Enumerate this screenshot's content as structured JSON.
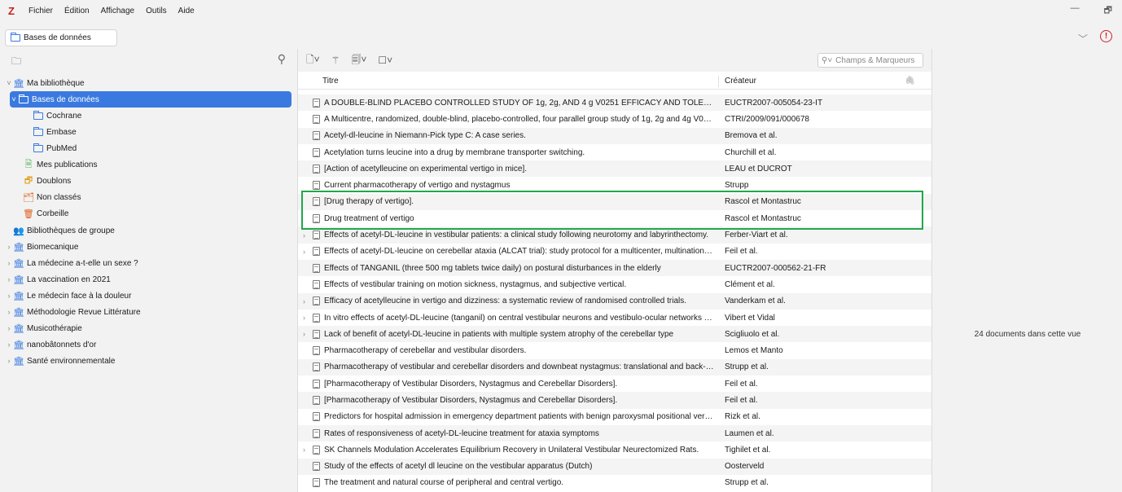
{
  "menubar": {
    "logo": "Z",
    "items": [
      "Fichier",
      "Édition",
      "Affichage",
      "Outils",
      "Aide"
    ]
  },
  "window_controls": {
    "minimize": "—",
    "restore": "🗗"
  },
  "tabbar": {
    "tab_label": "Bases de données",
    "alert": "!"
  },
  "sidebar": {
    "tree": [
      {
        "label": "Ma bibliothèque",
        "icon": "library-icon",
        "twisty": "˅",
        "indent": 0
      },
      {
        "label": "Bases de données",
        "icon": "folder-icon",
        "twisty": "˅",
        "indent": 1,
        "selected": true
      },
      {
        "label": "Cochrane",
        "icon": "folder-icon",
        "twisty": "",
        "indent": 2
      },
      {
        "label": "Embase",
        "icon": "folder-icon",
        "twisty": "",
        "indent": 2
      },
      {
        "label": "PubMed",
        "icon": "folder-icon",
        "twisty": "",
        "indent": 2
      },
      {
        "label": "Mes publications",
        "icon": "publications-icon",
        "twisty": "",
        "indent": 1
      },
      {
        "label": "Doublons",
        "icon": "duplicates-icon",
        "twisty": "",
        "indent": 1
      },
      {
        "label": "Non classés",
        "icon": "unfiled-icon",
        "twisty": "",
        "indent": 1
      },
      {
        "label": "Corbeille",
        "icon": "trash-icon",
        "twisty": "",
        "indent": 1
      },
      {
        "label": "Bibliothèques de groupe",
        "icon": "group-icon",
        "twisty": "",
        "indent": 0
      },
      {
        "label": "Biomecanique",
        "icon": "library-icon",
        "twisty": "›",
        "indent": 0
      },
      {
        "label": "La médecine a-t-elle un sexe ?",
        "icon": "library-icon",
        "twisty": "›",
        "indent": 0
      },
      {
        "label": "La vaccination en 2021",
        "icon": "library-icon",
        "twisty": "›",
        "indent": 0
      },
      {
        "label": "Le médecin face à la douleur",
        "icon": "library-icon",
        "twisty": "›",
        "indent": 0
      },
      {
        "label": "Méthodologie Revue Littérature",
        "icon": "library-icon",
        "twisty": "›",
        "indent": 0
      },
      {
        "label": "Musicothérapie",
        "icon": "library-icon",
        "twisty": "›",
        "indent": 0
      },
      {
        "label": "nanobâtonnets d'or",
        "icon": "library-icon",
        "twisty": "›",
        "indent": 0
      },
      {
        "label": "Santé environnementale",
        "icon": "library-icon",
        "twisty": "›",
        "indent": 0
      }
    ]
  },
  "main": {
    "search_placeholder": "Champs & Marqueurs",
    "columns": {
      "title": "Titre",
      "creator": "Créateur"
    },
    "items": [
      {
        "title": "A DOUBLE-BLIND PLACEBO CONTROLLED STUDY OF 1g, 2g, AND 4 g V0251 EFFICACY AND TOLERANCE IN VEST...",
        "creator": "EUCTR2007-005054-23-IT",
        "expandable": false
      },
      {
        "title": "A Multicentre, randomized, double-blind, placebo-controlled, four parallel group study of 1g, 2g and 4g V0251 ...",
        "creator": "CTRI/2009/091/000678",
        "expandable": false
      },
      {
        "title": "Acetyl-dl-leucine in Niemann-Pick type C: A case series.",
        "creator": "Bremova et al.",
        "expandable": false
      },
      {
        "title": "Acetylation turns leucine into a drug by membrane transporter switching.",
        "creator": "Churchill et al.",
        "expandable": false
      },
      {
        "title": "[Action of acetylleucine on experimental vertigo in mice].",
        "creator": "LEAU et DUCROT",
        "expandable": false
      },
      {
        "title": "Current pharmacotherapy of vertigo and nystagmus",
        "creator": "Strupp",
        "expandable": false
      },
      {
        "title": "[Drug therapy of vertigo].",
        "creator": "Rascol et Montastruc",
        "expandable": false
      },
      {
        "title": "Drug treatment of vertigo",
        "creator": "Rascol et Montastruc",
        "expandable": false
      },
      {
        "title": "Effects of acetyl-DL-leucine in vestibular patients: a clinical study following neurotomy and labyrinthectomy.",
        "creator": "Ferber-Viart et al.",
        "expandable": true
      },
      {
        "title": "Effects of acetyl-DL-leucine on cerebellar ataxia (ALCAT trial): study protocol for a multicenter, multinational, ran...",
        "creator": "Feil et al.",
        "expandable": true
      },
      {
        "title": "Effects of TANGANIL (three 500 mg tablets twice daily) on postural disturbances in the elderly",
        "creator": "EUCTR2007-000562-21-FR",
        "expandable": false
      },
      {
        "title": "Effects of vestibular training on motion sickness, nystagmus, and subjective vertical.",
        "creator": "Clément et al.",
        "expandable": false
      },
      {
        "title": "Efficacy of acetylleucine in vertigo and dizziness: a systematic review of randomised controlled trials.",
        "creator": "Vanderkam et al.",
        "expandable": true
      },
      {
        "title": "In vitro effects of acetyl-DL-leucine (tanganil) on central vestibular neurons and vestibulo-ocular networks of the ...",
        "creator": "Vibert et Vidal",
        "expandable": true
      },
      {
        "title": "Lack of benefit of acetyl-DL-leucine in patients with multiple system atrophy of the cerebellar type",
        "creator": "Scigliuolo et al.",
        "expandable": true
      },
      {
        "title": "Pharmacotherapy of cerebellar and vestibular disorders.",
        "creator": "Lemos et Manto",
        "expandable": false
      },
      {
        "title": "Pharmacotherapy of vestibular and cerebellar disorders and downbeat nystagmus: translational and back-transl...",
        "creator": "Strupp et al.",
        "expandable": false
      },
      {
        "title": "[Pharmacotherapy of Vestibular Disorders, Nystagmus and Cerebellar Disorders].",
        "creator": "Feil et al.",
        "expandable": false
      },
      {
        "title": "[Pharmacotherapy of Vestibular Disorders, Nystagmus and Cerebellar Disorders].",
        "creator": "Feil et al.",
        "expandable": false
      },
      {
        "title": "Predictors for hospital admission in emergency department patients with benign paroxysmal positional vertigo: ...",
        "creator": "Rizk et al.",
        "expandable": false
      },
      {
        "title": "Rates of responsiveness of acetyl-DL-leucine treatment for ataxia symptoms",
        "creator": "Laumen et al.",
        "expandable": false
      },
      {
        "title": "SK Channels Modulation Accelerates Equilibrium Recovery in Unilateral Vestibular Neurectomized Rats.",
        "creator": "Tighilet et al.",
        "expandable": true
      },
      {
        "title": "Study of the effects of acetyl dl leucine on the vestibular apparatus (Dutch)",
        "creator": "Oosterveld",
        "expandable": false
      },
      {
        "title": "The treatment and natural course of peripheral and central vertigo.",
        "creator": "Strupp et al.",
        "expandable": false
      }
    ]
  },
  "rightpane": {
    "count_text": "24 documents dans cette vue"
  },
  "colors": {
    "accent": "#3a7ae0",
    "highlight": "#1fa84a",
    "brand": "#cc1f1f"
  }
}
